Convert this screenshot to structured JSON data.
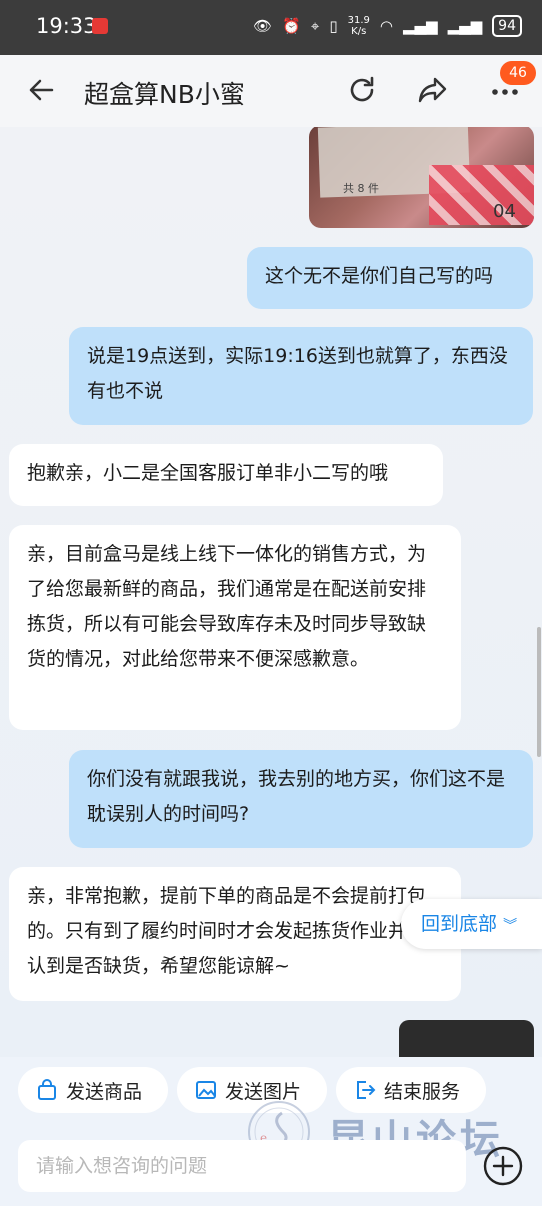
{
  "status_bar": {
    "time": "19:33",
    "speed_value": "31.9",
    "speed_unit": "K/s",
    "battery": "94"
  },
  "header": {
    "title": "超盒算NB小蜜",
    "badge_count": "46"
  },
  "messages": [
    {
      "from": "me",
      "text": "这个无不是你们自己写的吗"
    },
    {
      "from": "me",
      "text": "说是19点送到，实际19:16送到也就算了，东西没有也不说"
    },
    {
      "from": "them",
      "text": "抱歉亲，小二是全国客服订单非小二写的哦"
    },
    {
      "from": "them",
      "text": "亲，目前盒马是线上线下一体化的销售方式，为了给您最新鲜的商品，我们通常是在配送前安排拣货，所以有可能会导致库存未及时同步导致缺货的情况，对此给您带来不便深感歉意。"
    },
    {
      "from": "me",
      "text": "你们没有就跟我说，我去别的地方买，你们这不是耽误别人的时间吗?"
    },
    {
      "from": "them",
      "text": "亲，非常抱歉，提前下单的商品是不会提前打包的。只有到了履约时间时才会发起拣货作业并确认到是否缺货，希望您能谅解~"
    }
  ],
  "photo": {
    "receipt_number": "04",
    "receipt_footer": "共 8 件"
  },
  "scroll_to_bottom": "回到底部",
  "quick_actions": {
    "send_product": "发送商品",
    "send_image": "发送图片",
    "end_service": "结束服务"
  },
  "input": {
    "placeholder": "请输入想咨询的问题"
  },
  "watermark": {
    "text": "昆山论坛"
  },
  "colors": {
    "my_bubble": "#bfe0fa",
    "their_bubble": "#ffffff",
    "accent": "#1a86e6",
    "badge": "#ff5a1f"
  }
}
